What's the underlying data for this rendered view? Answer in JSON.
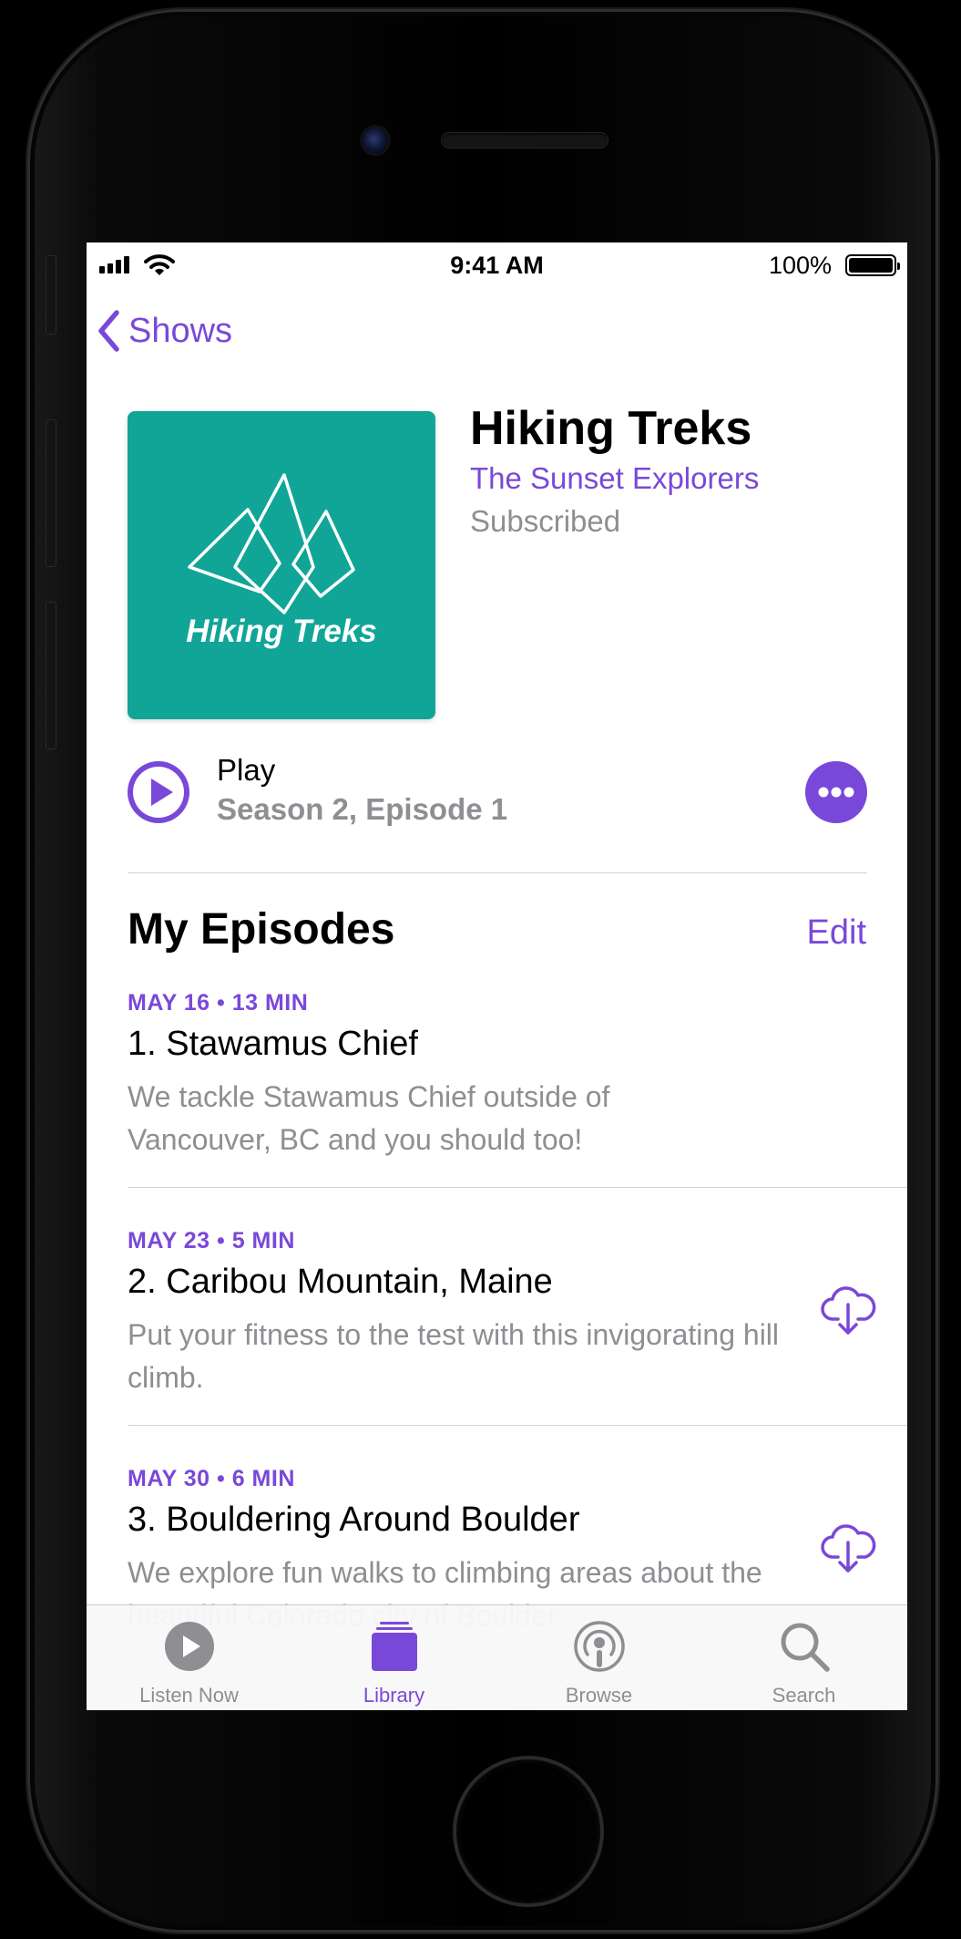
{
  "status_bar": {
    "time": "9:41 AM",
    "battery_percent": "100%",
    "battery_level": 1.0
  },
  "nav": {
    "back_label": "Shows"
  },
  "show": {
    "artwork_text": "Hiking Treks",
    "title": "Hiking Treks",
    "author": "The Sunset Explorers",
    "subscription_status": "Subscribed"
  },
  "play": {
    "label": "Play",
    "episode": "Season 2, Episode 1"
  },
  "episodes_section": {
    "title": "My Episodes",
    "edit_label": "Edit",
    "items": [
      {
        "meta": "MAY 16 • 13 MIN",
        "title": "1. Stawamus Chief",
        "description": "We tackle Stawamus Chief outside of Vancouver, BC and you should too!",
        "download_icon": false
      },
      {
        "meta": "MAY 23 • 5 MIN",
        "title": "2. Caribou Mountain, Maine",
        "description": "Put your fitness to the test with this invigorating hill climb.",
        "download_icon": "download-cloud-icon"
      },
      {
        "meta": "MAY 30 • 6 MIN",
        "title": "3. Bouldering Around Boulder",
        "description": "We explore fun walks to climbing areas about the beautiful Colorado city of Boulder.",
        "download_icon": "download-cloud-icon"
      }
    ]
  },
  "tab_bar": {
    "items": [
      {
        "label": "Listen Now",
        "icon": "play-circle-icon",
        "active": false
      },
      {
        "label": "Library",
        "icon": "library-icon",
        "active": true
      },
      {
        "label": "Browse",
        "icon": "podcast-icon",
        "active": false
      },
      {
        "label": "Search",
        "icon": "search-icon",
        "active": false
      }
    ]
  },
  "colors": {
    "accent": "#7a48d9",
    "artwork_background": "#11a598",
    "secondary_text": "#8e8e93"
  }
}
